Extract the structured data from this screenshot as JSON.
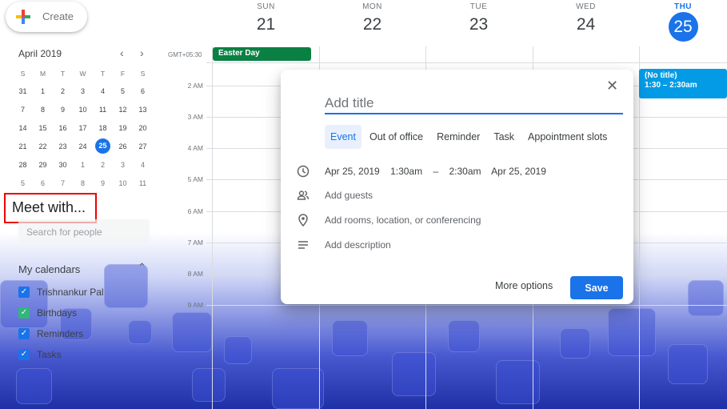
{
  "create_button": {
    "label": "Create"
  },
  "mini_calendar": {
    "month_label": "April 2019",
    "weekday_headers": [
      "S",
      "M",
      "T",
      "W",
      "T",
      "F",
      "S"
    ],
    "weeks": [
      [
        "31",
        "1",
        "2",
        "3",
        "4",
        "5",
        "6"
      ],
      [
        "7",
        "8",
        "9",
        "10",
        "11",
        "12",
        "13"
      ],
      [
        "14",
        "15",
        "16",
        "17",
        "18",
        "19",
        "20"
      ],
      [
        "21",
        "22",
        "23",
        "24",
        "25",
        "26",
        "27"
      ],
      [
        "28",
        "29",
        "30",
        "1",
        "2",
        "3",
        "4"
      ],
      [
        "5",
        "6",
        "7",
        "8",
        "9",
        "10",
        "11"
      ]
    ],
    "selected_day": "25"
  },
  "meet_with": {
    "title": "Meet with...",
    "search_placeholder": "Search for people"
  },
  "my_calendars": {
    "title": "My calendars",
    "items": [
      "Trishnankur Pal",
      "Birthdays",
      "Reminders",
      "Tasks"
    ]
  },
  "week_header": {
    "days": [
      {
        "name": "SUN",
        "num": "21"
      },
      {
        "name": "MON",
        "num": "22"
      },
      {
        "name": "TUE",
        "num": "23"
      },
      {
        "name": "WED",
        "num": "24"
      },
      {
        "name": "THU",
        "num": "25"
      }
    ],
    "timezone": "GMT+05:30"
  },
  "time_labels": [
    "2 AM",
    "3 AM",
    "4 AM",
    "5 AM",
    "6 AM",
    "7 AM",
    "8 AM",
    "9 AM"
  ],
  "events": {
    "all_day": "Easter Day",
    "no_title": {
      "title": "(No title)",
      "time": "1:30 – 2:30am"
    }
  },
  "dialog": {
    "title_placeholder": "Add title",
    "tabs": [
      "Event",
      "Out of office",
      "Reminder",
      "Task",
      "Appointment slots"
    ],
    "start_date": "Apr 25, 2019",
    "start_time": "1:30am",
    "dash": "–",
    "end_time": "2:30am",
    "end_date": "Apr 25, 2019",
    "add_guests": "Add guests",
    "add_location": "Add rooms, location, or conferencing",
    "add_description": "Add description",
    "more_options": "More options",
    "save": "Save"
  }
}
